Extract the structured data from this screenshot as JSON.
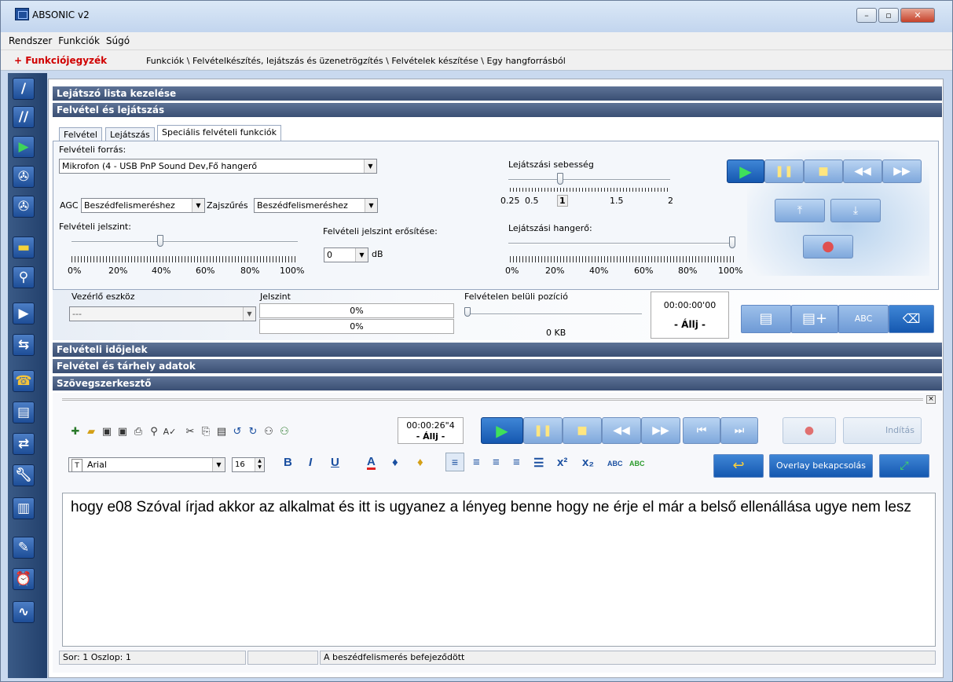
{
  "window": {
    "title": "ABSONIC v2"
  },
  "menu": {
    "items": [
      "Rendszer",
      "Funkciók",
      "Súgó"
    ]
  },
  "path": {
    "func_list": "+ Funkciójegyzék",
    "breadcrumb": "Funkciók \\ Felvételkészítés, lejátszás és üzenetrögzítés \\ Felvételek készítése \\ Egy hangforrásból"
  },
  "sections": {
    "playlist": "Lejátszó lista kezelése",
    "rec_play": "Felvétel és lejátszás",
    "timesignals": "Felvételi időjelek",
    "storage": "Felvétel és tárhely adatok",
    "texteditor": "Szövegszerkesztő"
  },
  "tabs": [
    "Felvétel",
    "Lejátszás",
    "Speciális felvételi funkciók"
  ],
  "rec": {
    "source_label": "Felvételi forrás:",
    "source_value": "Mikrofon (4 - USB PnP Sound Dev,Fő hangerő",
    "agc_label": "AGC",
    "agc_value": "Beszédfelismeréshez",
    "noise_label": "Zajszűrés",
    "noise_value": "Beszédfelismeréshez",
    "level_label": "Felvételi jelszint:",
    "level_ticks": [
      "0%",
      "20%",
      "40%",
      "60%",
      "80%",
      "100%"
    ],
    "gain_label": "Felvételi jelszint erősítése:",
    "gain_value": "0",
    "gain_unit": "dB",
    "speed_label": "Lejátszási sebesség",
    "speed_ticks": [
      "0.25",
      "0.5",
      "1",
      "1.5",
      "2"
    ],
    "volume_label": "Lejátszási hangerő:",
    "volume_ticks": [
      "0%",
      "20%",
      "40%",
      "60%",
      "80%",
      "100%"
    ]
  },
  "device": {
    "label": "Vezérlő eszköz",
    "value": "---",
    "level_label": "Jelszint",
    "level1": "0%",
    "level2": "0%",
    "pos_label": "Felvételen belüli pozíció",
    "size": "0 KB",
    "time": "00:00:00'00",
    "state": "- Állj -"
  },
  "editor_toolbar": {
    "time": "00:00:26\"4",
    "state": "- Állj -",
    "start_label": "Indítás",
    "font": "Arial",
    "size": "16",
    "overlay": "Overlay bekapcsolás"
  },
  "editor": {
    "text": "hogy e08 Szóval írjad akkor az alkalmat és itt is ugyanez a lényeg benne hogy ne érje el már a belső ellenállása ugye nem lesz"
  },
  "status": {
    "pos": "Sor:  1  Oszlop:  1",
    "msg": "A beszédfelismerés befejeződött"
  }
}
